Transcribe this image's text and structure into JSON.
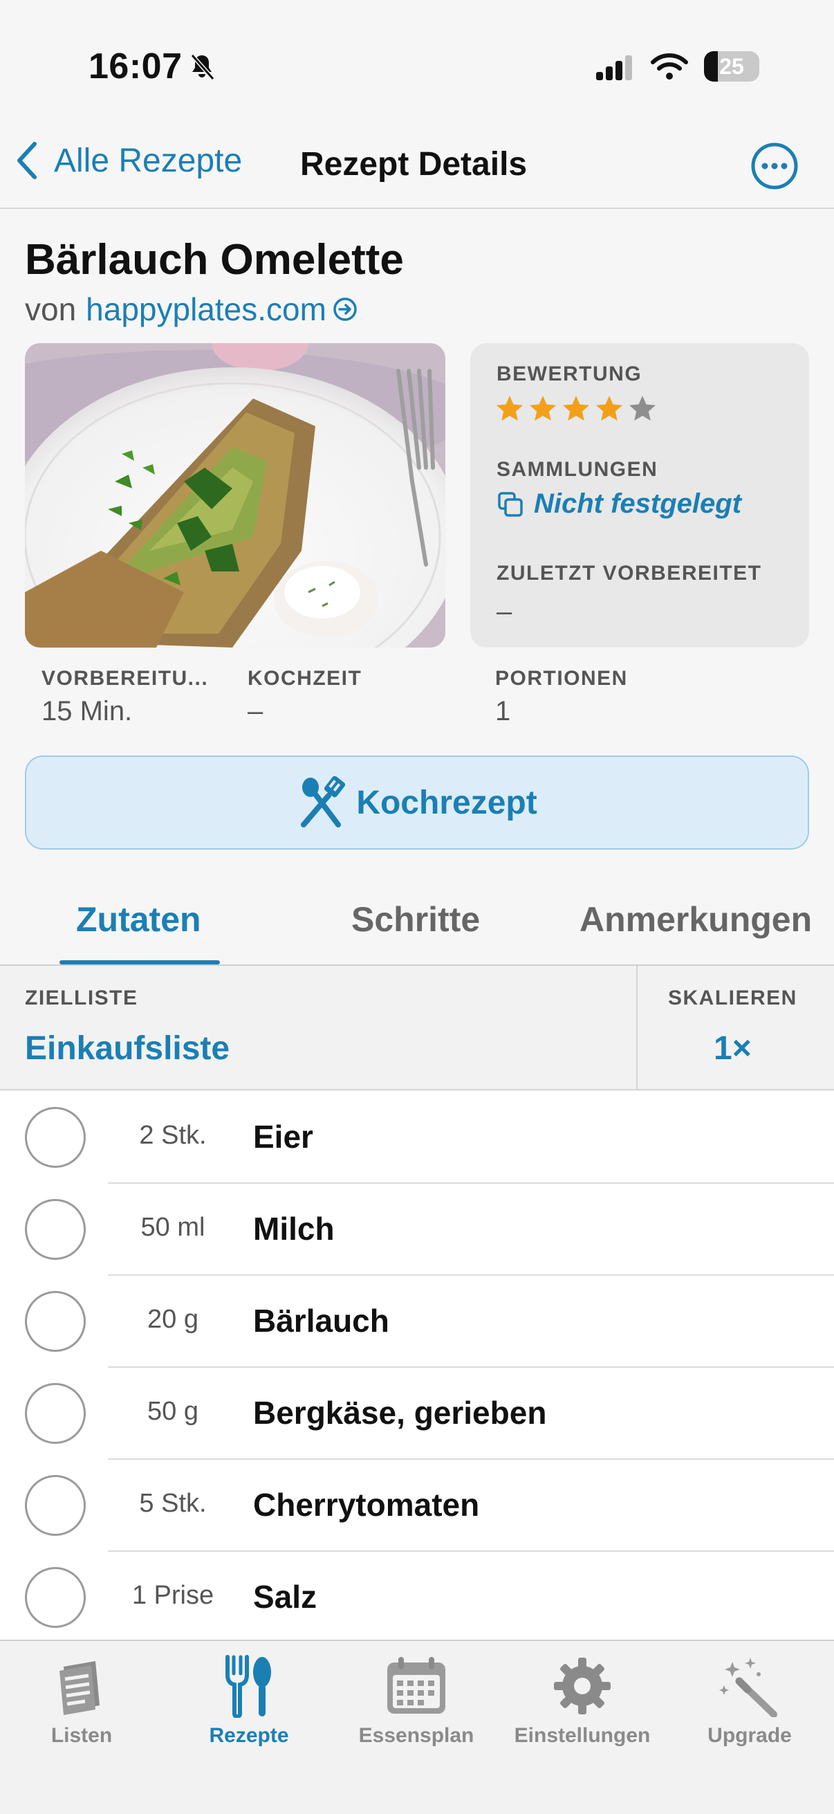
{
  "status_bar": {
    "time": "16:07",
    "battery": "25"
  },
  "nav": {
    "back_label": "Alle Rezepte",
    "title": "Rezept Details"
  },
  "recipe": {
    "title": "Bärlauch Omelette",
    "source_prefix": "von",
    "source_link": "happyplates.com"
  },
  "info": {
    "rating_label": "BEWERTUNG",
    "rating": 4,
    "rating_max": 5,
    "collections_label": "SAMMLUNGEN",
    "collections_value": "Nicht festgelegt",
    "last_prepared_label": "ZULETZT VORBEREITET",
    "last_prepared_value": "–"
  },
  "meta": {
    "prep_label": "VORBEREITU...",
    "prep_value": "15 Min.",
    "cook_label": "KOCHZEIT",
    "cook_value": "–",
    "servings_label": "PORTIONEN",
    "servings_value": "1"
  },
  "cook_button": {
    "label": "Kochrezept"
  },
  "tabs": [
    {
      "label": "Zutaten",
      "active": true
    },
    {
      "label": "Schritte",
      "active": false
    },
    {
      "label": "Anmerkungen",
      "active": false
    }
  ],
  "list_bar": {
    "target_label": "ZIELLISTE",
    "target_value": "Einkaufsliste",
    "scale_label": "SKALIEREN",
    "scale_value": "1×"
  },
  "ingredients": [
    {
      "amount": "2 Stk.",
      "name": "Eier"
    },
    {
      "amount": "50 ml",
      "name": "Milch"
    },
    {
      "amount": "20 g",
      "name": "Bärlauch"
    },
    {
      "amount": "50 g",
      "name": "Bergkäse, gerieben"
    },
    {
      "amount": "5 Stk.",
      "name": "Cherrytomaten"
    },
    {
      "amount": "1 Prise",
      "name": "Salz"
    }
  ],
  "tabbar": [
    {
      "label": "Listen",
      "icon": "list-icon",
      "active": false
    },
    {
      "label": "Rezepte",
      "icon": "fork-spoon-icon",
      "active": true
    },
    {
      "label": "Essensplan",
      "icon": "calendar-icon",
      "active": false
    },
    {
      "label": "Einstellungen",
      "icon": "gear-icon",
      "active": false
    },
    {
      "label": "Upgrade",
      "icon": "magic-wand-icon",
      "active": false
    }
  ],
  "colors": {
    "accent": "#1b7fb4",
    "star": "#f2a01c",
    "star_empty": "#8e8e8e",
    "button_bg": "#dcedf9"
  }
}
